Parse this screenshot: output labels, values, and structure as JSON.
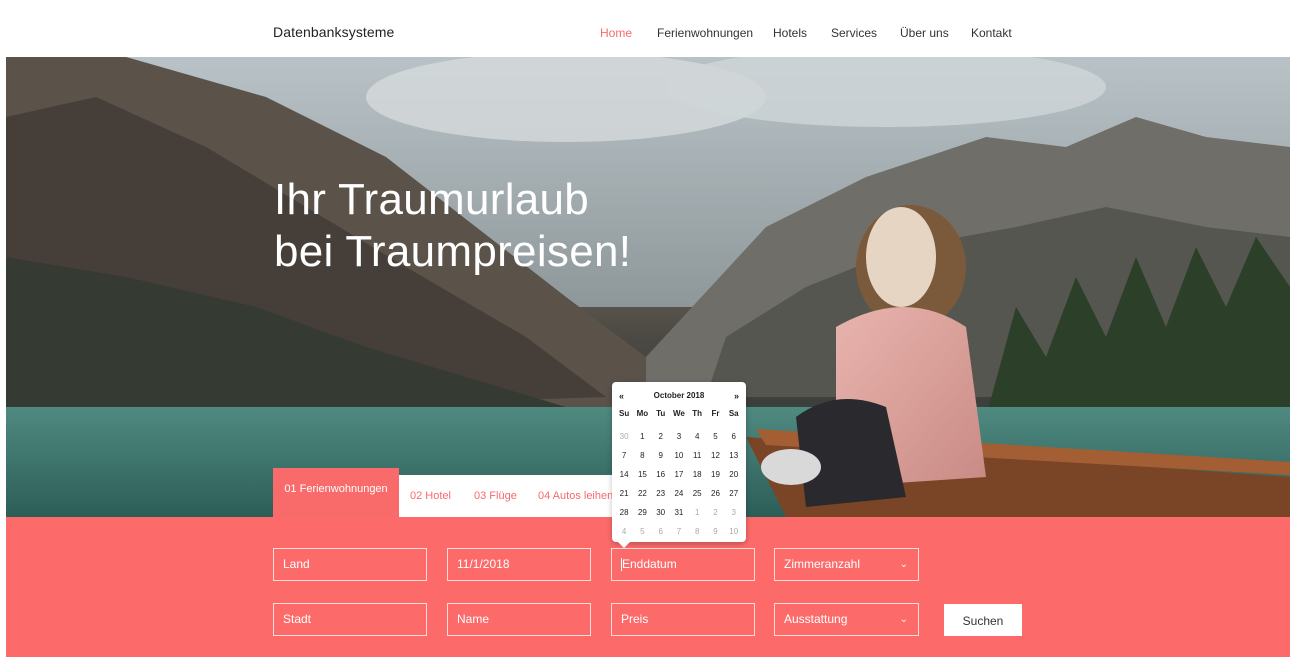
{
  "brand": "Datenbanksysteme",
  "nav": {
    "items": [
      {
        "label": "Home",
        "active": true
      },
      {
        "label": "Ferienwohnungen",
        "active": false
      },
      {
        "label": "Hotels",
        "active": false
      },
      {
        "label": "Services",
        "active": false
      },
      {
        "label": "Über uns",
        "active": false
      },
      {
        "label": "Kontakt",
        "active": false
      }
    ]
  },
  "hero": {
    "line1": "Ihr Traumurlaub",
    "line2": "bei Traumpreisen!"
  },
  "tabs": [
    {
      "label": "01 Ferienwohnungen",
      "active": true
    },
    {
      "label": "02 Hotel",
      "active": false
    },
    {
      "label": "03 Flüge",
      "active": false
    },
    {
      "label": "04 Autos leihen",
      "active": false
    }
  ],
  "form": {
    "land": "Land",
    "startdate": "11/1/2018",
    "enddate": "Enddatum",
    "rooms": "Zimmeranzahl",
    "stadt": "Stadt",
    "name": "Name",
    "preis": "Preis",
    "ausstattung": "Ausstattung",
    "search_label": "Suchen"
  },
  "datepicker": {
    "prev": "«",
    "next": "»",
    "title": "October 2018",
    "dow": [
      "Su",
      "Mo",
      "Tu",
      "We",
      "Th",
      "Fr",
      "Sa"
    ],
    "weeks": [
      [
        {
          "d": "30",
          "m": true
        },
        {
          "d": "1"
        },
        {
          "d": "2"
        },
        {
          "d": "3"
        },
        {
          "d": "4"
        },
        {
          "d": "5"
        },
        {
          "d": "6"
        }
      ],
      [
        {
          "d": "7"
        },
        {
          "d": "8"
        },
        {
          "d": "9"
        },
        {
          "d": "10"
        },
        {
          "d": "11"
        },
        {
          "d": "12"
        },
        {
          "d": "13"
        }
      ],
      [
        {
          "d": "14"
        },
        {
          "d": "15"
        },
        {
          "d": "16"
        },
        {
          "d": "17"
        },
        {
          "d": "18"
        },
        {
          "d": "19"
        },
        {
          "d": "20"
        }
      ],
      [
        {
          "d": "21"
        },
        {
          "d": "22"
        },
        {
          "d": "23"
        },
        {
          "d": "24"
        },
        {
          "d": "25"
        },
        {
          "d": "26"
        },
        {
          "d": "27"
        }
      ],
      [
        {
          "d": "28"
        },
        {
          "d": "29"
        },
        {
          "d": "30"
        },
        {
          "d": "31"
        },
        {
          "d": "1",
          "m": true
        },
        {
          "d": "2",
          "m": true
        },
        {
          "d": "3",
          "m": true
        }
      ],
      [
        {
          "d": "4",
          "m": true
        },
        {
          "d": "5",
          "m": true
        },
        {
          "d": "6",
          "m": true
        },
        {
          "d": "7",
          "m": true
        },
        {
          "d": "8",
          "m": true
        },
        {
          "d": "9",
          "m": true
        },
        {
          "d": "10",
          "m": true
        }
      ]
    ]
  },
  "colors": {
    "accent": "#fc6b6a",
    "nav_active": "#f96a6a"
  }
}
